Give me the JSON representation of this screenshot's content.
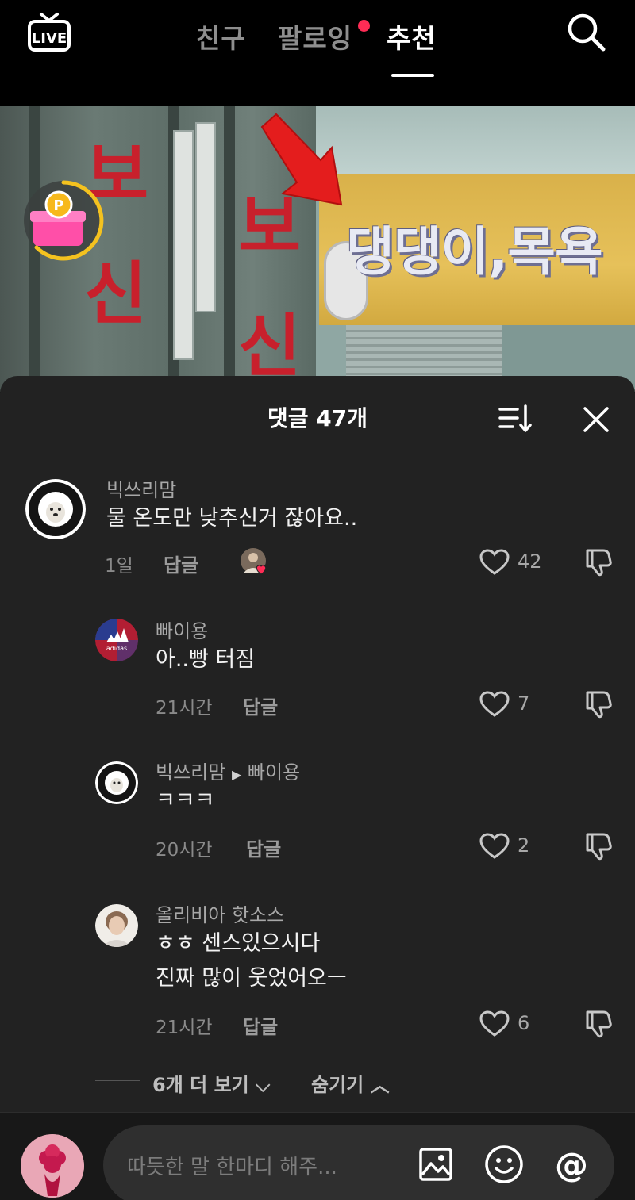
{
  "top_nav": {
    "live_label": "LIVE",
    "tabs": [
      {
        "label": "친구",
        "active": false
      },
      {
        "label": "팔로잉",
        "active": false,
        "has_notification_dot": true
      },
      {
        "label": "추천",
        "active": true
      }
    ]
  },
  "video": {
    "sign_text": "댕댕이,목욕",
    "left_sign_chars": [
      "보",
      "신",
      "보",
      "신"
    ]
  },
  "comments_sheet": {
    "title": "댓글 47개",
    "comments": [
      {
        "username": "빅쓰리맘",
        "text": "물 온도만 낮추신거 잖아요..",
        "time": "1일",
        "reply_label": "답글",
        "creator_liked": true,
        "likes": "42"
      },
      {
        "username": "빠이용",
        "text": "아..빵 터짐",
        "time": "21시간",
        "reply_label": "답글",
        "likes": "7"
      },
      {
        "username": "빅쓰리맘",
        "reply_to": "빠이용",
        "text": "ㅋㅋㅋ",
        "time": "20시간",
        "reply_label": "답글",
        "likes": "2"
      },
      {
        "username": "올리비아 핫소스",
        "text_lines": [
          "ㅎㅎ 센스있으시다",
          "진짜 많이 웃었어오ㅡ"
        ],
        "time": "21시간",
        "reply_label": "답글",
        "likes": "6"
      }
    ],
    "more_label": "6개 더 보기",
    "hide_label": "숨기기"
  },
  "composer": {
    "placeholder": "따듯한 말 한마디 해주..."
  },
  "colors": {
    "background": "#000000",
    "sheet": "#222222",
    "accent_red": "#fe2c55",
    "sign_yellow": "#e6c15a"
  }
}
